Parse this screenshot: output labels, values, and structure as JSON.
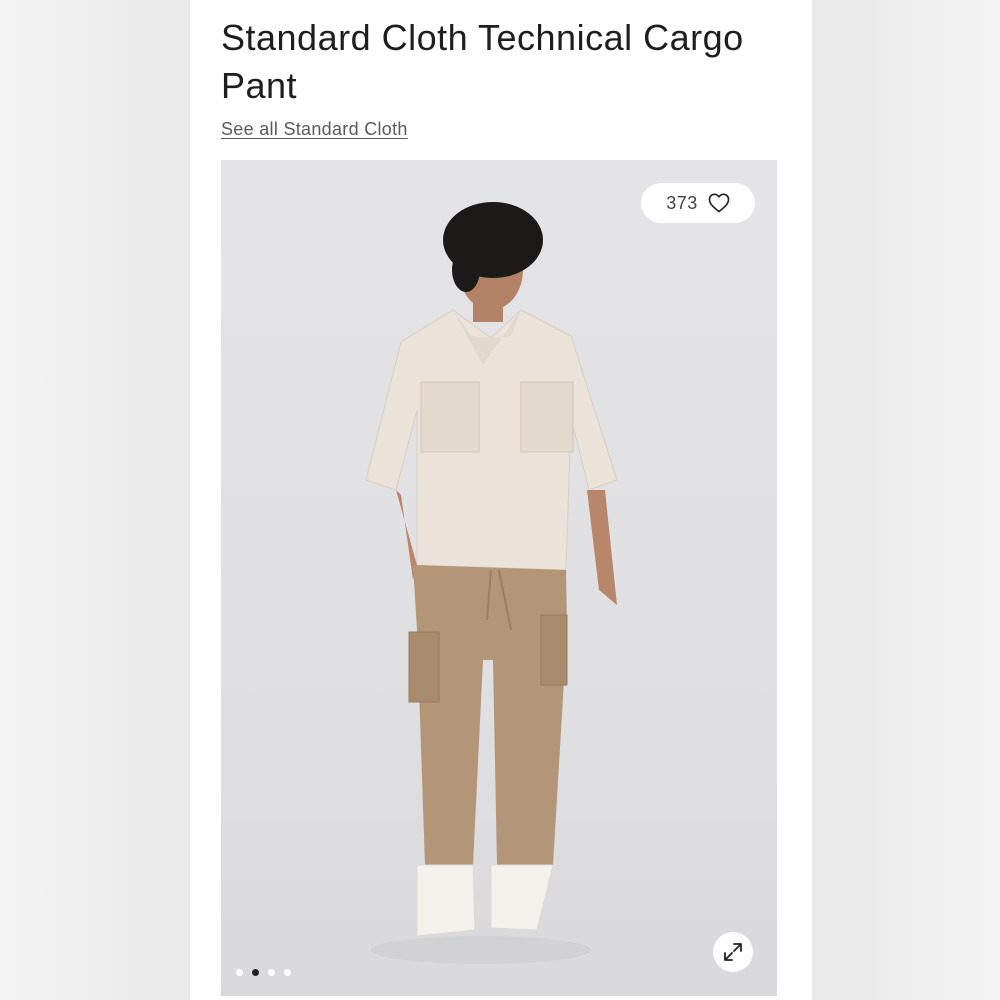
{
  "product": {
    "title": "Standard Cloth Technical Cargo Pant",
    "brand_link": "See all Standard Cloth"
  },
  "gallery": {
    "like_count": "373",
    "like_icon": "heart-icon",
    "expand_icon": "expand-icon",
    "slide_count": 4,
    "active_slide": 2
  },
  "colors": {
    "background": "#e2e2e4",
    "shirt": "#ebe3d9",
    "pants": "#b39578",
    "accent_text": "#1e1e1e"
  }
}
